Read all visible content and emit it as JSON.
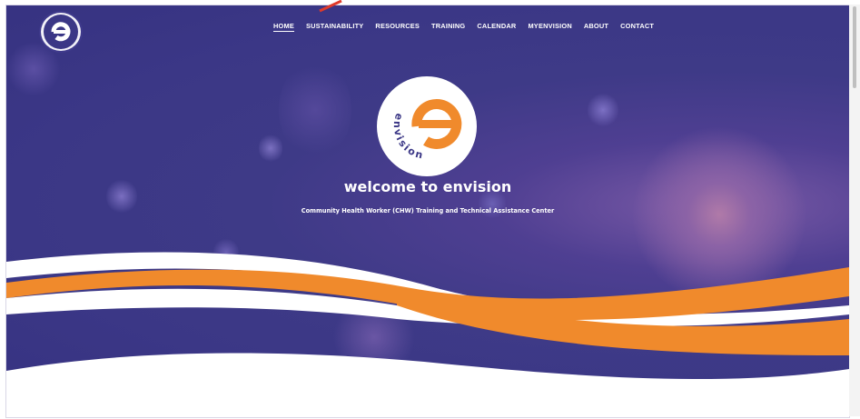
{
  "nav": {
    "items": [
      {
        "label": "HOME",
        "active": true
      },
      {
        "label": "SUSTAINABILITY",
        "active": false
      },
      {
        "label": "RESOURCES",
        "active": false
      },
      {
        "label": "TRAINING",
        "active": false
      },
      {
        "label": "CALENDAR",
        "active": false
      },
      {
        "label": "MYENVISION",
        "active": false
      },
      {
        "label": "ABOUT",
        "active": false
      },
      {
        "label": "CONTACT",
        "active": false
      }
    ]
  },
  "logo": {
    "text": "envision",
    "icon": "envision-e-logo"
  },
  "hero": {
    "title": "welcome to envision",
    "subtitle": "Community Health Worker (CHW) Training and Technical Assistance Center"
  },
  "colors": {
    "brand_purple": "#3b3786",
    "brand_orange": "#f08a2c",
    "white": "#ffffff"
  }
}
